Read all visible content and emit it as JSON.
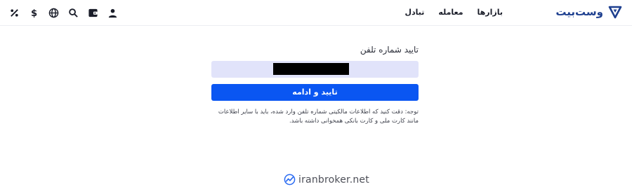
{
  "header": {
    "brand_name": "وست‌بیت",
    "nav": [
      "بازارها",
      "معامله",
      "تبادل"
    ],
    "icons": [
      "fee-icon",
      "dollar-icon",
      "globe-icon",
      "search-icon",
      "wallet-icon",
      "user-icon"
    ]
  },
  "form": {
    "title": "تایید شماره تلفن",
    "phone_value": "",
    "submit_label": "تایید و ادامه",
    "note": "توجه: دقت کنید که اطلاعات مالکیتی شماره تلفن وارد شده، باید با سایر اطلاعات مانند کارت ملی و کارت بانکی همخوانی داشته باشد."
  },
  "watermark": {
    "text": "iranbroker.net"
  },
  "colors": {
    "brand": "#1d3f8f",
    "accent": "#0a56f2",
    "input_bg": "#e1e3fa"
  }
}
